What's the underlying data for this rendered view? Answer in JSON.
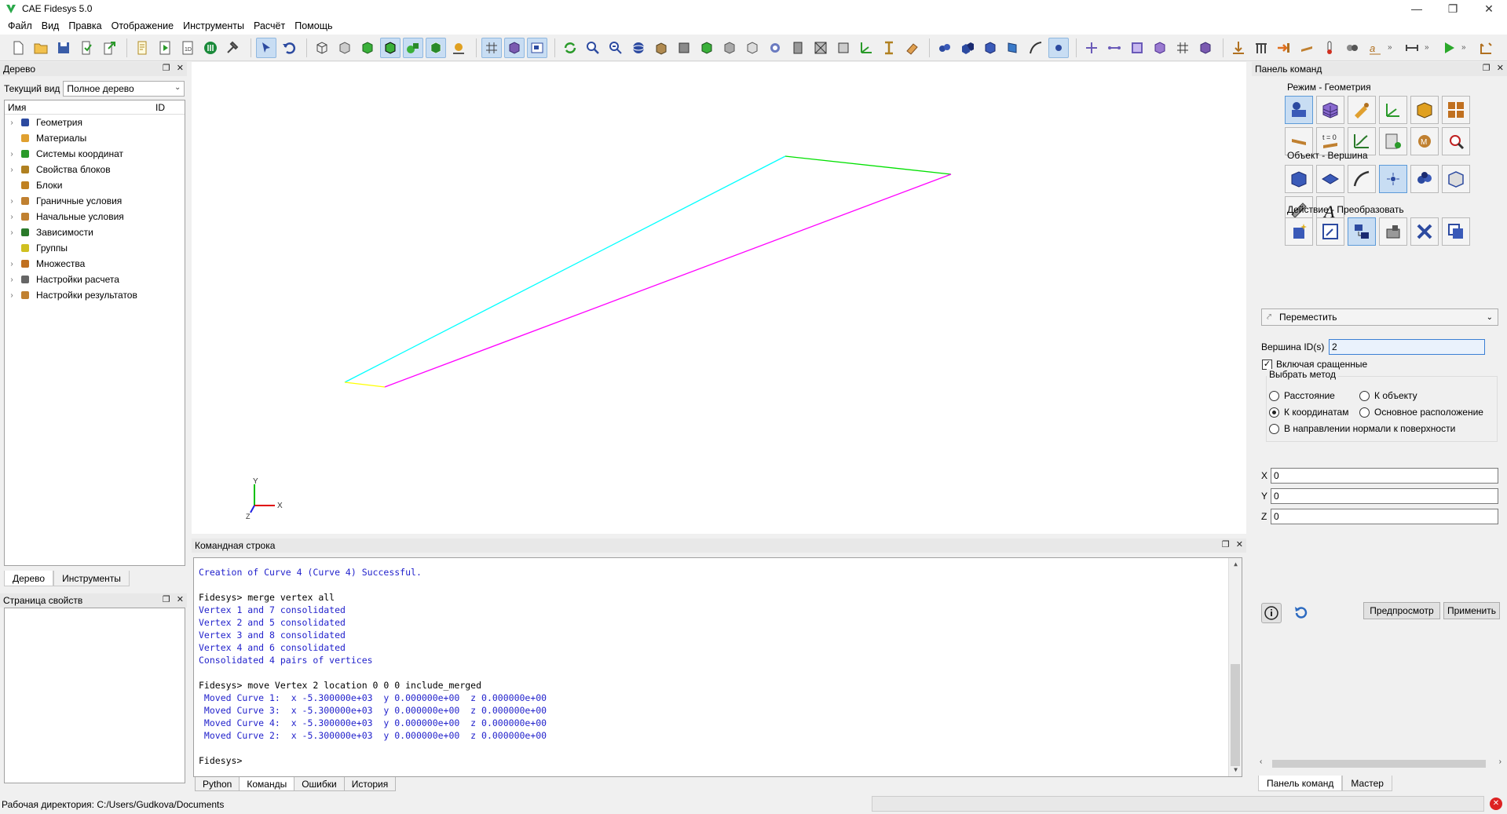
{
  "window": {
    "title": "CAE Fidesys 5.0"
  },
  "menu": [
    "Файл",
    "Вид",
    "Правка",
    "Отображение",
    "Инструменты",
    "Расчёт",
    "Помощь"
  ],
  "colors": {
    "accent": "#c8ddf3",
    "output_text": "#2222cc",
    "curve1": "#00ffff",
    "curve2": "#00e000",
    "curve3": "#ff00ff",
    "curve4": "#ffff00"
  },
  "tree_panel": {
    "title": "Дерево",
    "current_view_label": "Текущий вид",
    "current_view_value": "Полное дерево",
    "col_name": "Имя",
    "col_id": "ID",
    "items": [
      {
        "label": "Геометрия",
        "icon": "geometry-icon",
        "expandable": true
      },
      {
        "label": "Материалы",
        "icon": "materials-icon",
        "expandable": false
      },
      {
        "label": "Системы координат",
        "icon": "coordinate-systems-icon",
        "expandable": true
      },
      {
        "label": "Свойства блоков",
        "icon": "block-properties-icon",
        "expandable": true
      },
      {
        "label": "Блоки",
        "icon": "blocks-icon",
        "expandable": false
      },
      {
        "label": "Граничные условия",
        "icon": "boundary-conditions-icon",
        "expandable": true
      },
      {
        "label": "Начальные условия",
        "icon": "initial-conditions-icon",
        "expandable": true
      },
      {
        "label": "Зависимости",
        "icon": "dependencies-icon",
        "expandable": true
      },
      {
        "label": "Группы",
        "icon": "groups-icon",
        "expandable": false
      },
      {
        "label": "Множества",
        "icon": "sets-icon",
        "expandable": true
      },
      {
        "label": "Настройки расчета",
        "icon": "calc-settings-icon",
        "expandable": true
      },
      {
        "label": "Настройки результатов",
        "icon": "result-settings-icon",
        "expandable": true
      }
    ],
    "tabs": [
      "Дерево",
      "Инструменты"
    ]
  },
  "props_panel": {
    "title": "Страница свойств"
  },
  "viewport": {
    "axis_labels": {
      "x": "X",
      "y": "Y",
      "z": "Z"
    }
  },
  "command_line": {
    "title": "Командная строка",
    "lines": [
      {
        "type": "out",
        "text": "Creation of Curve 4 (Curve 4) Successful."
      },
      {
        "type": "gap",
        "text": ""
      },
      {
        "type": "in",
        "text": "Fidesys> merge vertex all"
      },
      {
        "type": "out",
        "text": "Vertex 1 and 7 consolidated"
      },
      {
        "type": "out",
        "text": "Vertex 2 and 5 consolidated"
      },
      {
        "type": "out",
        "text": "Vertex 3 and 8 consolidated"
      },
      {
        "type": "out",
        "text": "Vertex 4 and 6 consolidated"
      },
      {
        "type": "out",
        "text": "Consolidated 4 pairs of vertices"
      },
      {
        "type": "gap",
        "text": ""
      },
      {
        "type": "in",
        "text": "Fidesys> move Vertex 2 location 0 0 0 include_merged"
      },
      {
        "type": "out",
        "text": " Moved Curve 1:  x -5.300000e+03  y 0.000000e+00  z 0.000000e+00"
      },
      {
        "type": "out",
        "text": " Moved Curve 3:  x -5.300000e+03  y 0.000000e+00  z 0.000000e+00"
      },
      {
        "type": "out",
        "text": " Moved Curve 4:  x -5.300000e+03  y 0.000000e+00  z 0.000000e+00"
      },
      {
        "type": "out",
        "text": " Moved Curve 2:  x -5.300000e+03  y 0.000000e+00  z 0.000000e+00"
      },
      {
        "type": "gap",
        "text": ""
      },
      {
        "type": "in",
        "text": "Fidesys> "
      }
    ],
    "tabs": [
      "Python",
      "Команды",
      "Ошибки",
      "История"
    ],
    "selected_tab": 1
  },
  "command_panel": {
    "title": "Панель команд",
    "mode_label": "Режим - Геометрия",
    "object_label": "Объект - Вершина",
    "action_label": "Действие - Преобразовать",
    "action_select": "Переместить",
    "vertex_id_label": "Вершина ID(s)",
    "vertex_id_value": "2",
    "include_merged_label": "Включая сращенные",
    "method_label": "Выбрать метод",
    "methods": [
      "Расстояние",
      "К объекту",
      "К координатам",
      "Основное расположение",
      "В направлении нормали к поверхности"
    ],
    "x_label": "X",
    "x_value": "0",
    "y_label": "Y",
    "y_value": "0",
    "z_label": "Z",
    "z_value": "0",
    "preview_label": "Предпросмотр",
    "apply_label": "Применить",
    "tabs": [
      "Панель команд",
      "Мастер"
    ]
  },
  "status": {
    "working_dir": "Рабочая директория: C:/Users/Gudkova/Documents"
  }
}
